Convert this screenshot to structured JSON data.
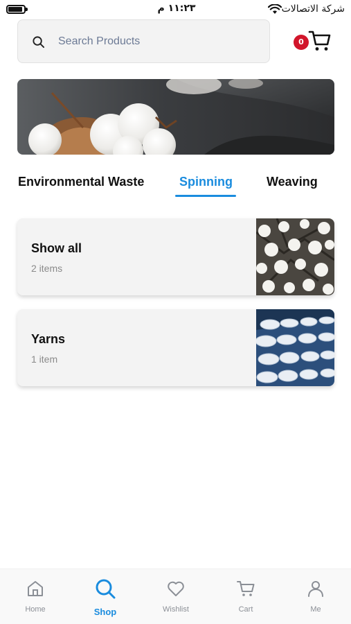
{
  "status_bar": {
    "time": "١١:٢٣ م",
    "carrier": "شركة الاتصالات"
  },
  "search": {
    "placeholder": "Search Products"
  },
  "cart": {
    "badge_count": "0"
  },
  "tabs": [
    {
      "label": "Environmental Waste",
      "active": false
    },
    {
      "label": "Spinning",
      "active": true
    },
    {
      "label": "Weaving",
      "active": false
    }
  ],
  "categories": [
    {
      "title": "Show all",
      "count": "2 items",
      "image": "cotton-bolls-photo"
    },
    {
      "title": "Yarns",
      "count": "1 item",
      "image": "yarn-spools-photo"
    }
  ],
  "bottom_nav": [
    {
      "label": "Home",
      "icon": "home-icon",
      "active": false
    },
    {
      "label": "Shop",
      "icon": "search-icon",
      "active": true
    },
    {
      "label": "Wishlist",
      "icon": "heart-icon",
      "active": false
    },
    {
      "label": "Cart",
      "icon": "cart-icon",
      "active": false
    },
    {
      "label": "Me",
      "icon": "user-icon",
      "active": false
    }
  ],
  "colors": {
    "accent": "#1a8cde",
    "badge": "#d2152b",
    "card_background": "#f3f3f3",
    "nav_inactive": "#8b8f96"
  }
}
